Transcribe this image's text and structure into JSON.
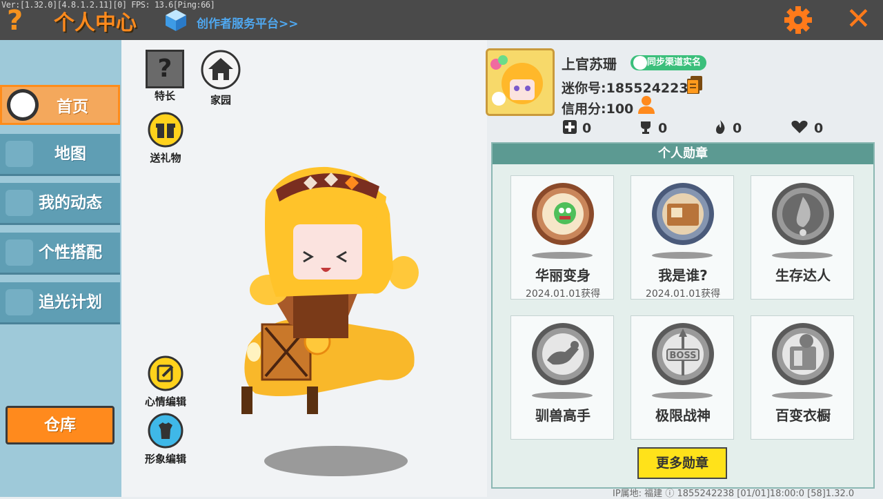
{
  "debug_text": "Ver:[1.32.0][4.8.1.2.11][0] FPS: 13.6[Ping:66]",
  "header": {
    "help_label": "?",
    "title": "个人中心",
    "creator_link": "创作者服务平台>>",
    "close_label": "✕",
    "gear_icon": "gear-icon"
  },
  "sidebar": {
    "items": [
      {
        "label": "首页",
        "active": true
      },
      {
        "label": "地图",
        "active": false
      },
      {
        "label": "我的动态",
        "active": false
      },
      {
        "label": "个性搭配",
        "active": false
      },
      {
        "label": "追光计划",
        "active": false
      }
    ],
    "warehouse_label": "仓库"
  },
  "center": {
    "specialty_label": "特长",
    "home_label": "家园",
    "gift_label": "送礼物",
    "mood_label": "心情编辑",
    "look_label": "形象编辑"
  },
  "profile": {
    "username": "上官苏珊",
    "sync_badge": "同步渠道实名",
    "mini_id": "迷你号:1855242238",
    "credit": "信用分:100",
    "stats": [
      {
        "icon": "plus-icon",
        "value": "0"
      },
      {
        "icon": "trophy-icon",
        "value": "0"
      },
      {
        "icon": "flame-icon",
        "value": "0"
      },
      {
        "icon": "heart-icon",
        "value": "0"
      }
    ]
  },
  "medals": {
    "header": "个人勋章",
    "items": [
      {
        "name": "华丽变身",
        "date": "2024.01.01获得",
        "color": "#c9865a",
        "earned": true
      },
      {
        "name": "我是谁?",
        "date": "2024.01.01获得",
        "color": "#8595b0",
        "earned": true
      },
      {
        "name": "生存达人",
        "date": "",
        "color": "#8a8a8a",
        "earned": false
      },
      {
        "name": "驯兽高手",
        "date": "",
        "color": "#8a8a8a",
        "earned": false
      },
      {
        "name": "极限战神",
        "date": "",
        "color": "#8a8a8a",
        "earned": false
      },
      {
        "name": "百变衣橱",
        "date": "",
        "color": "#8a8a8a",
        "earned": false
      }
    ],
    "more_label": "更多勋章"
  },
  "footer": "IP属地: 福建 ⓘ    1855242238    [01/01]18:00:0   [58]1.32.0"
}
